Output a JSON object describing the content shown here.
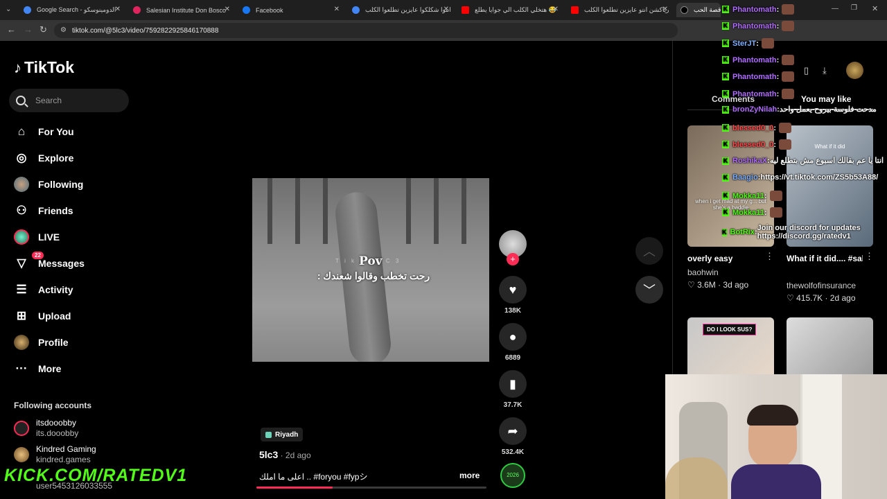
{
  "tabs": [
    {
      "title": "Google Search - الدومينوسكو",
      "fav_color": "#4285f4"
    },
    {
      "title": "Salesian Institute Don Bosco",
      "fav_color": "#e0245e"
    },
    {
      "title": "Facebook",
      "fav_color": "#1877f2"
    },
    {
      "title": "انتوا شكلكوا عايزين تطلعوا الكلب",
      "fav_color": "#4285f4"
    },
    {
      "title": "هتخلي الكلب الي جوايا يطلع 😂",
      "fav_color": "#ff0000"
    },
    {
      "title": "رياكشن انتو عايزين تطلعوا الكلب",
      "fav_color": "#ff0000"
    },
    {
      "title": "قصة الحب",
      "fav_color": "#000000"
    }
  ],
  "address": {
    "url": "tiktok.com/@5lc3/video/7592822925846170888"
  },
  "logo": {
    "text": "TikTok"
  },
  "search": {
    "placeholder": "Search"
  },
  "nav": [
    {
      "label": "For You",
      "icon": "home-icon"
    },
    {
      "label": "Explore",
      "icon": "compass-icon"
    },
    {
      "label": "Following",
      "icon": "following-avatar-icon"
    },
    {
      "label": "Friends",
      "icon": "friends-icon"
    },
    {
      "label": "LIVE",
      "icon": "live-icon"
    },
    {
      "label": "Messages",
      "icon": "messages-icon",
      "badge": "22"
    },
    {
      "label": "Activity",
      "icon": "activity-icon"
    },
    {
      "label": "Upload",
      "icon": "upload-icon"
    },
    {
      "label": "Profile",
      "icon": "profile-icon"
    },
    {
      "label": "More",
      "icon": "more-icon"
    }
  ],
  "following": {
    "title": "Following accounts",
    "accounts": [
      {
        "name": "itsdooobby",
        "handle": "its.dooobby"
      },
      {
        "name": "Kindred Gaming",
        "handle": "kindred.games"
      },
      {
        "name": "",
        "handle": "user5453126033555"
      }
    ]
  },
  "video": {
    "watermark": "T i k T o k   C 3",
    "overlay_title": "Pov",
    "overlay_caption": "رحت تخطب وقالوا شعندك :",
    "location": "Riyadh",
    "author": "5lc3",
    "date": " · 2d ago",
    "description": "اعلى ما املك .. #foryou #fypシ",
    "more": "more",
    "progress_fraction": 0.33
  },
  "actions": {
    "likes": "138K",
    "comments": "6889",
    "saves": "37.7K",
    "shares": "532.4K",
    "music_label": "2026"
  },
  "right_panel": {
    "comments_tab": "Comments",
    "maylike_tab": "You may like",
    "cards": [
      {
        "title": "overly easy",
        "author": "baohwin",
        "stats": "♡ 3.6M · 3d ago",
        "overlay": "when i get mad at my g... but she's a baddie"
      },
      {
        "title": "What if it did.... #sales #money...",
        "author": "thewolfofinsurance",
        "stats": "♡ 415.7K · 2d ago",
        "overlay": "What if it did"
      },
      {
        "title": "",
        "author": "",
        "stats": "",
        "overlay": "DO I LOOK SUS?"
      },
      {
        "title": "",
        "author": "",
        "stats": "",
        "overlay": ""
      }
    ]
  },
  "chat": [
    {
      "user": "Phantomath",
      "color": "#b06cff",
      "text": ""
    },
    {
      "user": "Phantomath",
      "color": "#b06cff",
      "text": ""
    },
    {
      "user": "SterJT",
      "color": "#7fb0ff",
      "text": ""
    },
    {
      "user": "Phantomath",
      "color": "#b06cff",
      "text": ""
    },
    {
      "user": "Phantomath",
      "color": "#b06cff",
      "text": ""
    },
    {
      "user": "Phantomath",
      "color": "#b06cff",
      "text": ""
    },
    {
      "user": "bronZyNilah",
      "color": "#b06cff",
      "text": "مدحت فلوسة بيروح يعمل واحد"
    },
    {
      "user": "blessed0_0",
      "color": "#ff4b4b",
      "text": ""
    },
    {
      "user": "blessed0_0",
      "color": "#ff4b4b",
      "text": ""
    },
    {
      "user": "RoshikaX",
      "color": "#b06cff",
      "text": "انتا يا عم بقالك اسبوع مش بتطلع ليه"
    },
    {
      "user": "Baagio",
      "color": "#7fb0ff",
      "text": "https://vt.tiktok.com/ZS5b53A88/"
    },
    {
      "user": "Mokka11",
      "color": "#53fc18",
      "text": ""
    },
    {
      "user": "Mokka11",
      "color": "#53fc18",
      "text": ""
    },
    {
      "user": "BotRix",
      "color": "#53fc18",
      "text": "Join our discord for updates https://discord.gg/ratedv1"
    }
  ],
  "kick_url": "KICK.COM/RATEDV1"
}
